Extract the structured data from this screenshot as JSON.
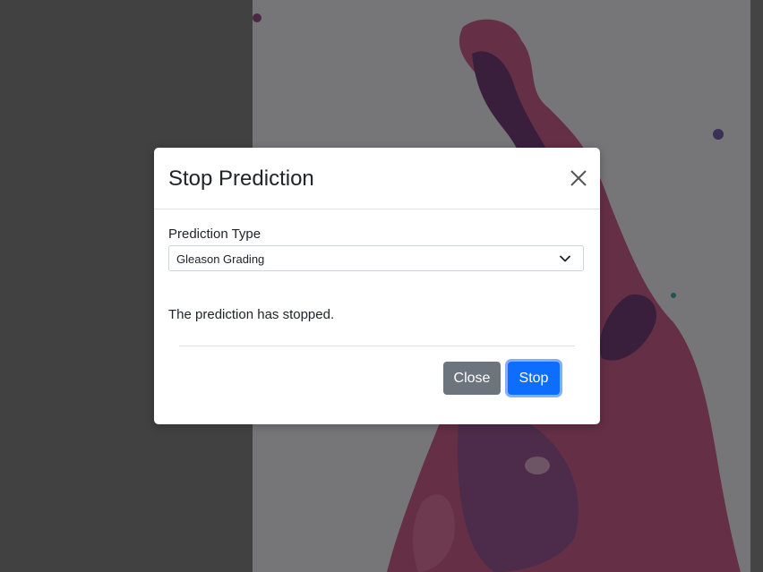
{
  "modal": {
    "title": "Stop Prediction",
    "close_icon": "close-icon",
    "field_label": "Prediction Type",
    "select_value": "Gleason Grading",
    "select_icon": "chevron-down-icon",
    "message": "The prediction has stopped.",
    "close_button_label": "Close",
    "stop_button_label": "Stop"
  },
  "colors": {
    "primary": "#0d6efd",
    "secondary": "#6c757d",
    "backdrop": "rgba(0,0,0,0.45)"
  }
}
